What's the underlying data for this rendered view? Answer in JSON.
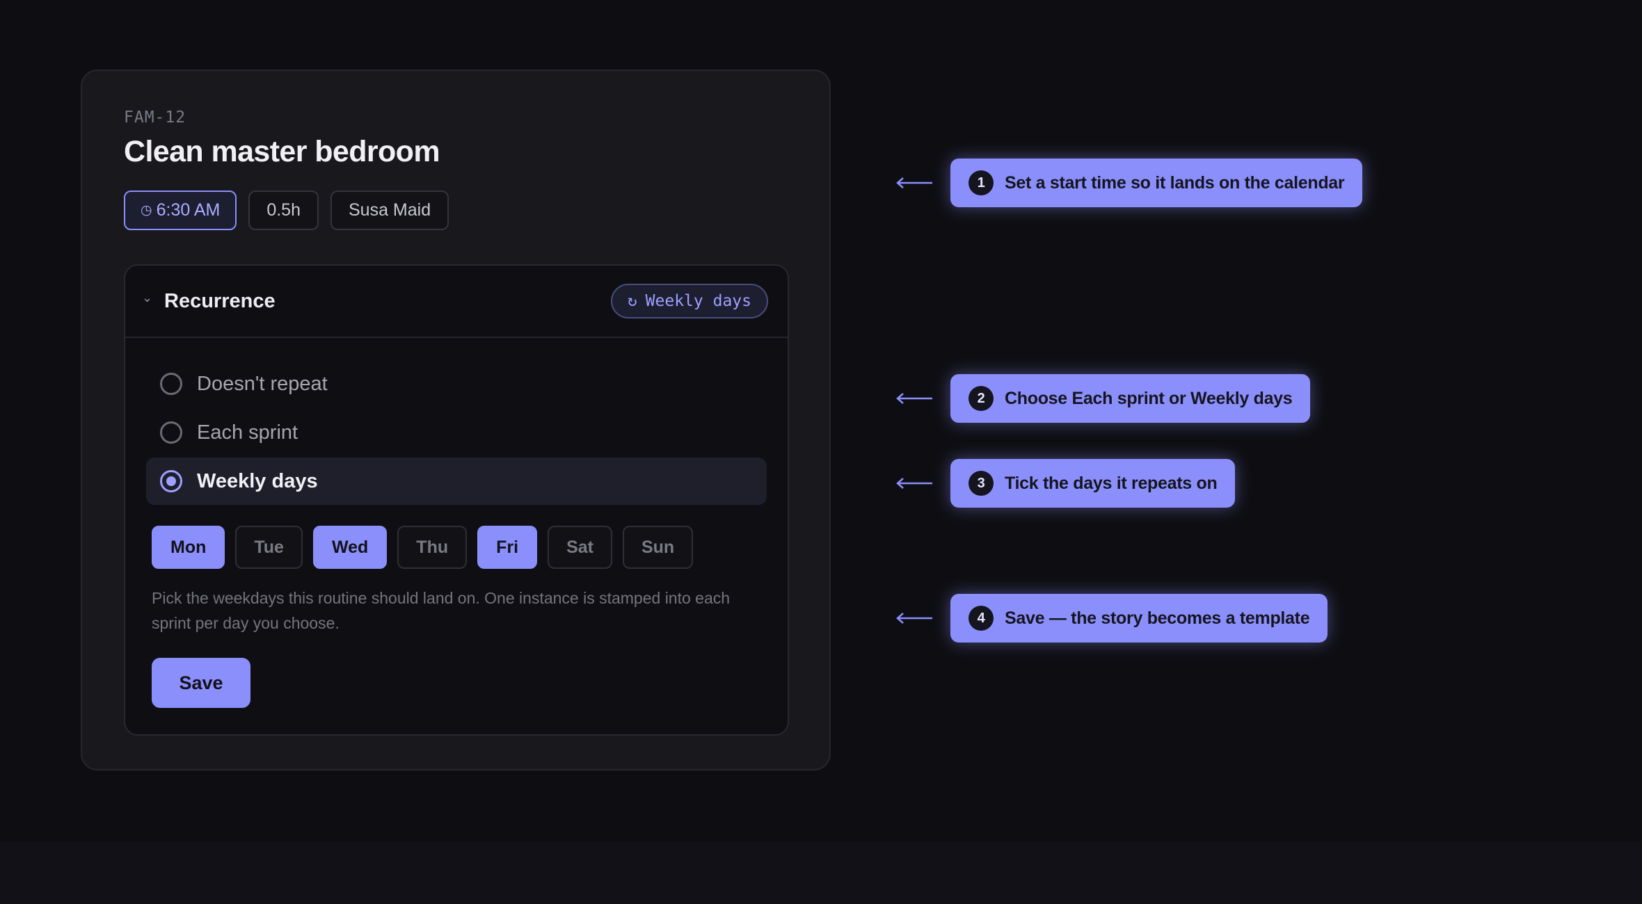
{
  "story": {
    "id": "FAM-12",
    "title": "Clean master bedroom",
    "chips": {
      "time": "6:30 AM",
      "estimate": "0.5h",
      "assignee": "Susa Maid"
    }
  },
  "recurrence": {
    "title": "Recurrence",
    "badge_icon": "↻",
    "badge_label": "Weekly days",
    "options": [
      {
        "label": "Doesn't repeat",
        "selected": false
      },
      {
        "label": "Each sprint",
        "selected": false
      },
      {
        "label": "Weekly days",
        "selected": true
      }
    ],
    "days": [
      {
        "label": "Mon",
        "on": true
      },
      {
        "label": "Tue",
        "on": false
      },
      {
        "label": "Wed",
        "on": true
      },
      {
        "label": "Thu",
        "on": false
      },
      {
        "label": "Fri",
        "on": true
      },
      {
        "label": "Sat",
        "on": false
      },
      {
        "label": "Sun",
        "on": false
      }
    ],
    "help_text": "Pick the weekdays this routine should land on. One instance is stamped into each sprint per day you choose.",
    "save_label": "Save"
  },
  "callouts": [
    {
      "num": "1",
      "text": "Set a start time so it lands on the calendar"
    },
    {
      "num": "2",
      "text": "Choose Each sprint or Weekly days"
    },
    {
      "num": "3",
      "text": "Tick the days it repeats on"
    },
    {
      "num": "4",
      "text": "Save — the story becomes a template"
    }
  ],
  "colors": {
    "accent": "#8b8ffb",
    "background": "#0e0e12",
    "card": "#18181d"
  }
}
